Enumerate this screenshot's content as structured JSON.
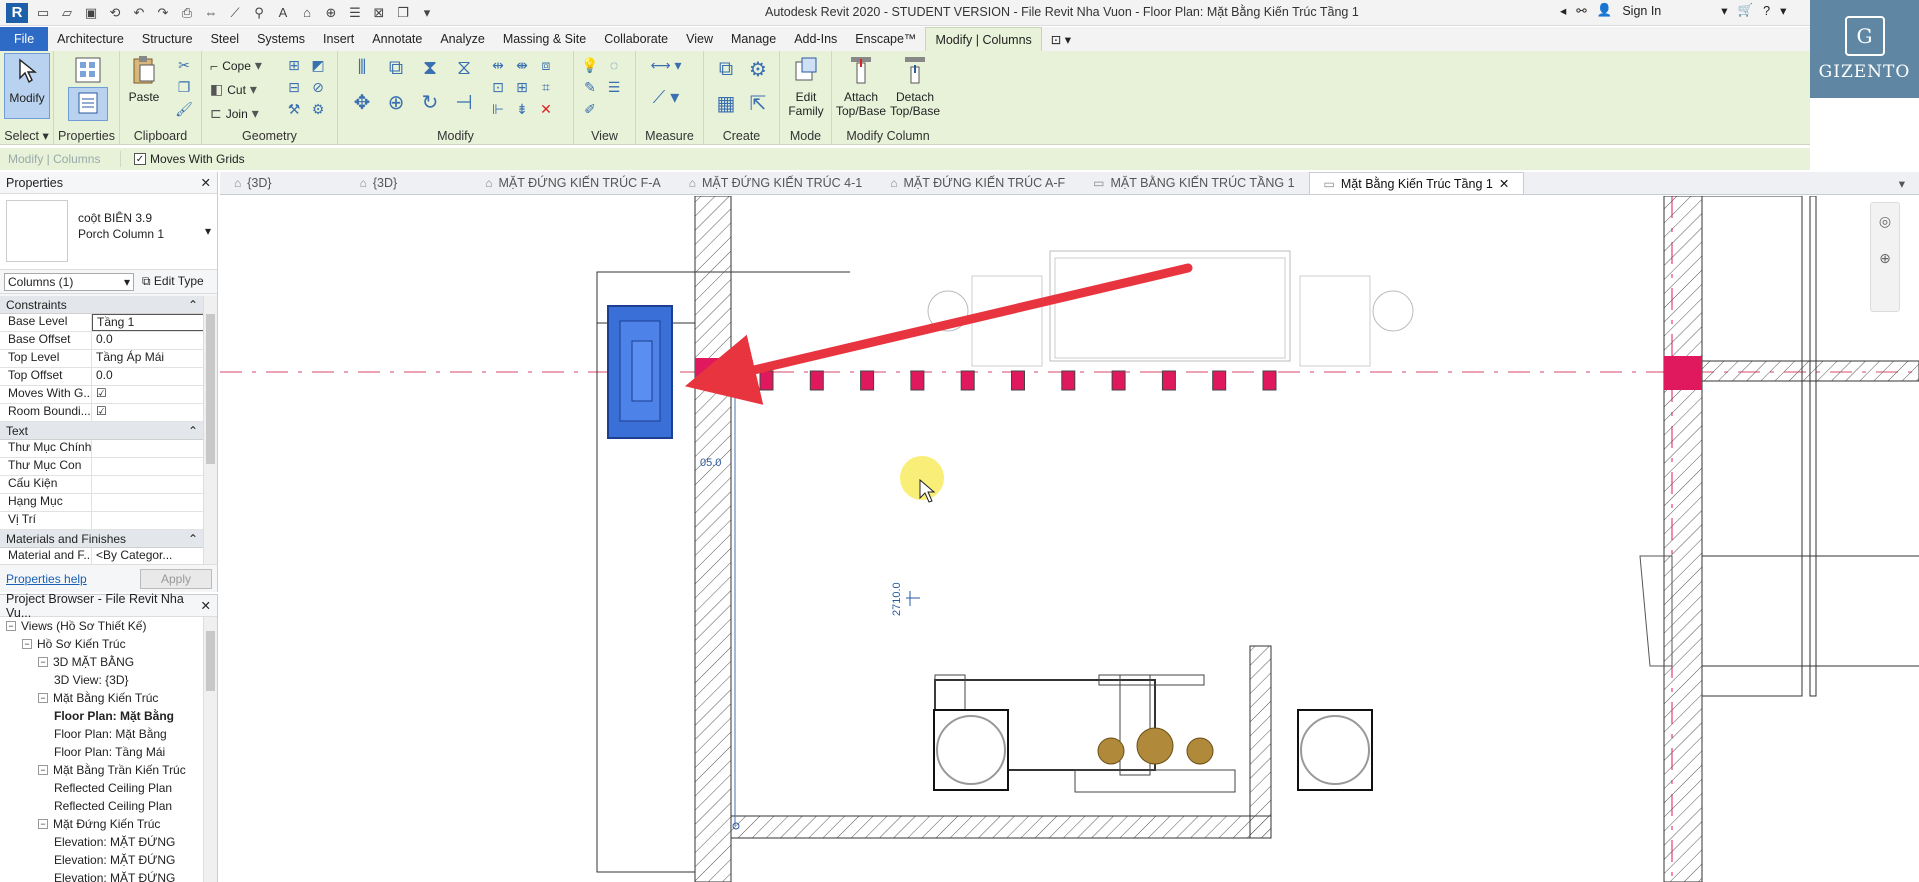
{
  "titlebar": {
    "title": "Autodesk Revit 2020 - STUDENT VERSION - File Revit Nha Vuon - Floor Plan: Mặt Bằng Kiến Trúc Tầng 1",
    "sign_in": "Sign In"
  },
  "ribbon_tabs": [
    "File",
    "Architecture",
    "Structure",
    "Steel",
    "Systems",
    "Insert",
    "Annotate",
    "Analyze",
    "Massing & Site",
    "Collaborate",
    "View",
    "Manage",
    "Add-Ins",
    "Enscape™",
    "Modify | Columns"
  ],
  "ribbon": {
    "modify_label": "Modify",
    "select_label": "Select ▾",
    "properties_label": "Properties",
    "paste_label": "Paste",
    "clipboard_label": "Clipboard",
    "cope_label": "Cope",
    "cut_label": "Cut",
    "join_label": "Join",
    "geometry_label": "Geometry",
    "modify_panel_label": "Modify",
    "view_label": "View",
    "measure_label": "Measure",
    "create_label": "Create",
    "edit_family_label": "Edit Family",
    "mode_label": "Mode",
    "attach_label": "Attach Top/Base",
    "detach_label": "Detach Top/Base",
    "modify_column_label": "Modify Column"
  },
  "optbar": {
    "context": "Modify | Columns",
    "moves_with_grids": "Moves With Grids"
  },
  "brand": {
    "name": "GIZENTO",
    "crest": "G"
  },
  "view_tabs": [
    {
      "label": "{3D}"
    },
    {
      "label": "{3D}"
    },
    {
      "label": "MẶT ĐỨNG KIẾN TRÚC F-A"
    },
    {
      "label": "MẶT ĐỨNG KIẾN TRÚC 4-1"
    },
    {
      "label": "MẶT ĐỨNG KIẾN TRÚC A-F"
    },
    {
      "label": "MẶT BẰNG KIẾN TRÚC TẦNG 1"
    },
    {
      "label": "Mặt Bằng Kiến Trúc Tầng 1"
    }
  ],
  "properties": {
    "header": "Properties",
    "type_name": "coột BIÊN 3.9",
    "type_sub": "Porch Column 1",
    "filter": "Columns (1)",
    "edit_type": "Edit Type",
    "sections": [
      {
        "title": "Constraints",
        "rows": [
          {
            "k": "Base Level",
            "v": "Tầng 1"
          },
          {
            "k": "Base Offset",
            "v": "0.0"
          },
          {
            "k": "Top Level",
            "v": "Tầng Áp Mái"
          },
          {
            "k": "Top Offset",
            "v": "0.0"
          },
          {
            "k": "Moves With G...",
            "v": "☑"
          },
          {
            "k": "Room Boundi...",
            "v": "☑"
          }
        ]
      },
      {
        "title": "Text",
        "rows": [
          {
            "k": "Thư Mục Chính",
            "v": ""
          },
          {
            "k": "Thư Mục Con",
            "v": ""
          },
          {
            "k": "Cấu Kiện",
            "v": ""
          },
          {
            "k": "Hạng Mục",
            "v": ""
          },
          {
            "k": "Vị Trí",
            "v": ""
          }
        ]
      },
      {
        "title": "Materials and Finishes",
        "rows": [
          {
            "k": "Material and F...",
            "v": "<By Categor..."
          }
        ]
      }
    ],
    "help_link": "Properties help",
    "apply": "Apply"
  },
  "browser": {
    "header": "Project Browser - File Revit Nha Vu...",
    "nodes": [
      {
        "label": "Views (Hồ Sơ Thiết Kế)",
        "indent": 0,
        "tw": "−"
      },
      {
        "label": "Hồ Sơ Kiến Trúc",
        "indent": 1,
        "tw": "−"
      },
      {
        "label": "3D MẶT BẰNG",
        "indent": 2,
        "tw": "−"
      },
      {
        "label": "3D View: {3D}",
        "indent": 3,
        "tw": ""
      },
      {
        "label": "Mặt Bằng Kiến Trúc",
        "indent": 2,
        "tw": "−"
      },
      {
        "label": "Floor Plan: Mặt Bằng",
        "indent": 3,
        "tw": "",
        "bold": true
      },
      {
        "label": "Floor Plan: Mặt Bằng",
        "indent": 3,
        "tw": ""
      },
      {
        "label": "Floor Plan: Tầng Mái",
        "indent": 3,
        "tw": ""
      },
      {
        "label": "Mặt Bằng Trần Kiến Trúc",
        "indent": 2,
        "tw": "−"
      },
      {
        "label": "Reflected Ceiling Plan",
        "indent": 3,
        "tw": ""
      },
      {
        "label": "Reflected Ceiling Plan",
        "indent": 3,
        "tw": ""
      },
      {
        "label": "Mặt Đứng Kiến Trúc",
        "indent": 2,
        "tw": "−"
      },
      {
        "label": "Elevation: MẶT ĐỨNG",
        "indent": 3,
        "tw": ""
      },
      {
        "label": "Elevation: MẶT ĐỨNG",
        "indent": 3,
        "tw": ""
      },
      {
        "label": "Elevation: MẶT ĐỨNG",
        "indent": 3,
        "tw": ""
      }
    ]
  },
  "canvas": {
    "dim_small": "05.0",
    "dim_long": "2710.0"
  },
  "colors": {
    "accent": "#2e6bc6",
    "ribbon_bg": "#e8f2d9",
    "selection_blue": "#3a6fd8",
    "column_magenta": "#e0195f",
    "arrow_red": "#e8343f",
    "brand_bg": "#5f87a3"
  }
}
